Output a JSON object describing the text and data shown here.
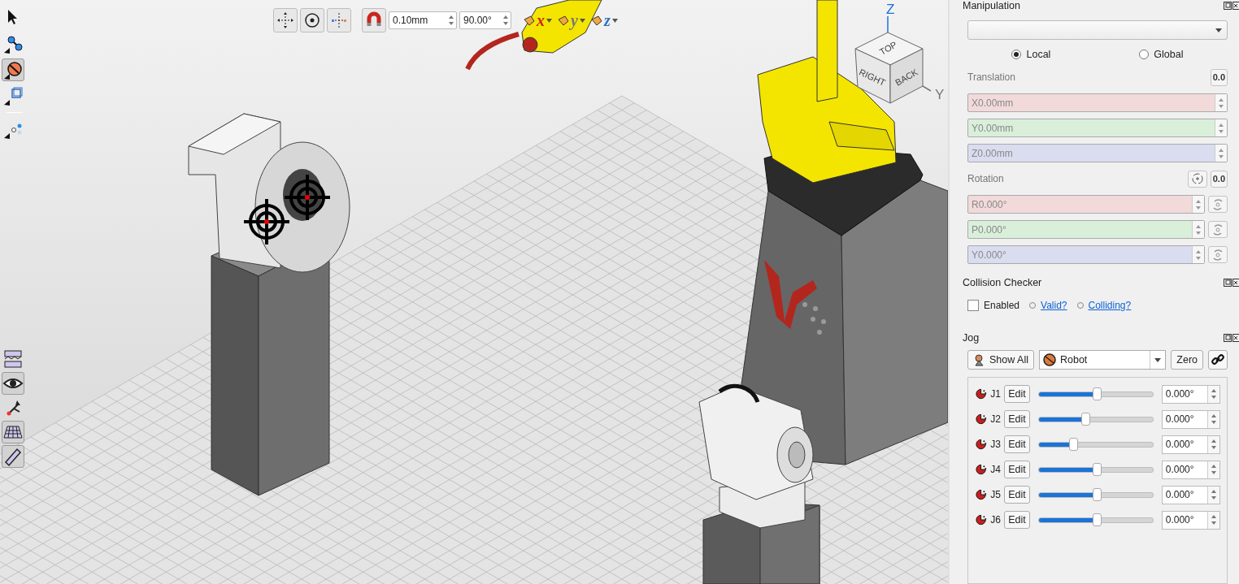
{
  "viewport": {
    "left_tools": [
      {
        "kind": "pointer",
        "selected": false
      },
      {
        "kind": "link",
        "selected": false
      },
      {
        "kind": "prohibit",
        "selected": true
      },
      {
        "kind": "frame",
        "selected": false
      },
      {
        "kind": "separator"
      },
      {
        "kind": "nodes",
        "selected": false
      }
    ],
    "bottom_tools": [
      {
        "kind": "layers",
        "selected": false
      },
      {
        "kind": "eye",
        "selected": true
      },
      {
        "kind": "frames",
        "selected": false
      },
      {
        "kind": "grid",
        "selected": true
      },
      {
        "kind": "ruler",
        "selected": true
      }
    ],
    "top_tools": {
      "translation_step": "0.10mm",
      "rotation_step": "90.00°",
      "axes": [
        "x",
        "y",
        "z"
      ]
    },
    "view_cube": {
      "faces": [
        "TOP",
        "RIGHT",
        "BACK"
      ],
      "axes": [
        "Z",
        "Y"
      ]
    }
  },
  "manipulation": {
    "title": "Manipulation",
    "frames": [
      {
        "label": "Local",
        "selected": true
      },
      {
        "label": "Global",
        "selected": false
      }
    ],
    "translation": {
      "label": "Translation",
      "reset": "0.0",
      "fields": [
        {
          "value": "X0.00mm",
          "color": "#f2dada"
        },
        {
          "value": "Y0.00mm",
          "color": "#d9efda"
        },
        {
          "value": "Z0.00mm",
          "color": "#dadcf0"
        }
      ]
    },
    "rotation": {
      "label": "Rotation",
      "reset": "0.0",
      "fields": [
        {
          "value": "R0.000°",
          "color": "#f2dada"
        },
        {
          "value": "P0.000°",
          "color": "#d9efda"
        },
        {
          "value": "Y0.000°",
          "color": "#dadcf0"
        }
      ]
    }
  },
  "collision_checker": {
    "title": "Collision Checker",
    "enabled": {
      "label": "Enabled",
      "checked": false
    },
    "indicators": [
      {
        "label": "Valid?",
        "on": false
      },
      {
        "label": "Colliding?",
        "on": false
      }
    ]
  },
  "jog": {
    "title": "Jog",
    "show_all": "Show All",
    "target": "Robot",
    "zero": "Zero",
    "joints": [
      {
        "name": "J1",
        "edit": "Edit",
        "level": 0.51,
        "value": "0.000°"
      },
      {
        "name": "J2",
        "edit": "Edit",
        "level": 0.41,
        "value": "0.000°"
      },
      {
        "name": "J3",
        "edit": "Edit",
        "level": 0.3,
        "value": "0.000°"
      },
      {
        "name": "J4",
        "edit": "Edit",
        "level": 0.51,
        "value": "0.000°"
      },
      {
        "name": "J5",
        "edit": "Edit",
        "level": 0.51,
        "value": "0.000°"
      },
      {
        "name": "J6",
        "edit": "Edit",
        "level": 0.51,
        "value": "0.000°"
      }
    ]
  }
}
